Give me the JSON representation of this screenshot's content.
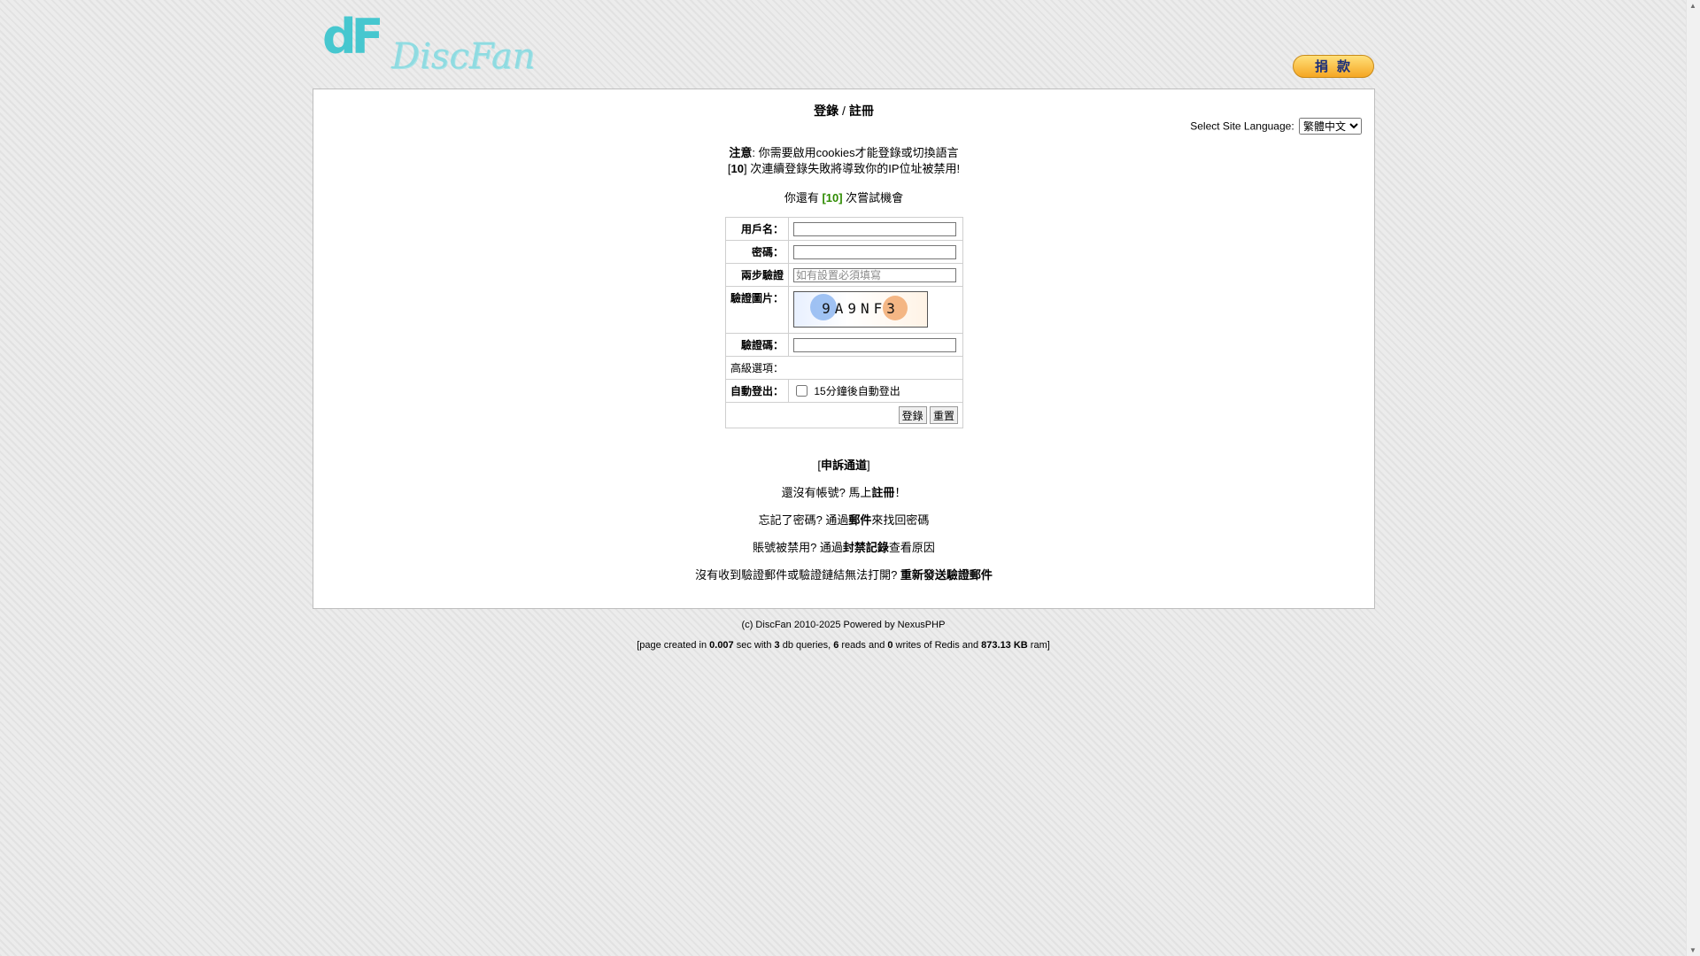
{
  "logo": {
    "mark": "dF",
    "name": "DiscFan"
  },
  "donate": {
    "label": "捐款"
  },
  "heading": {
    "login": "登錄",
    "sep": " / ",
    "register": "註冊"
  },
  "language": {
    "label": "Select Site Language:",
    "selected": "繁體中文"
  },
  "notice": {
    "bold": "注意",
    "text1": ": 你需要啟用cookies才能登錄或切換語言",
    "count": "10",
    "text2": "] 次連續登錄失敗將導致你的IP位址被禁用!"
  },
  "chance": {
    "pre": "你還有 ",
    "count": "[10]",
    "post": " 次嘗試機會"
  },
  "form": {
    "username_label": "用戶名：",
    "password_label": "密碼：",
    "twofa_label": "兩步驗證",
    "twofa_placeholder": "如有設置必須填寫",
    "captcha_label": "驗證圖片：",
    "captcha_code": "9A9NF3",
    "code_label": "驗證碼：",
    "advanced_label": "高級選項：",
    "autologout_label": "自動登出：",
    "autologout_option": "15分鐘後自動登出",
    "login_button": "登錄",
    "reset_button": "重置"
  },
  "links": {
    "appeal": "申訴通道",
    "no_account": "還沒有帳號? 馬上",
    "register": "註冊",
    "no_account_end": "！",
    "forgot": "忘記了密碼? 通過",
    "mail": "郵件",
    "forgot_end": "來找回密碼",
    "banned": "賬號被禁用? 通過",
    "ban_log": "封禁記錄",
    "banned_end": "查看原因",
    "no_mail": "沒有收到驗證郵件或驗證鏈結無法打開?",
    "resend": "重新發送驗證郵件"
  },
  "footer": {
    "copyright": "(c) DiscFan 2010-2025 Powered by NexusPHP",
    "stats_pre": "[page created in ",
    "time": "0.007",
    "stats_a": " sec with ",
    "queries": "3",
    "stats_b": " db queries, ",
    "reads": "6",
    "stats_c": " reads and ",
    "writes": "0",
    "stats_d": " writes of Redis and ",
    "ram": "873.13 KB",
    "stats_e": " ram]"
  }
}
